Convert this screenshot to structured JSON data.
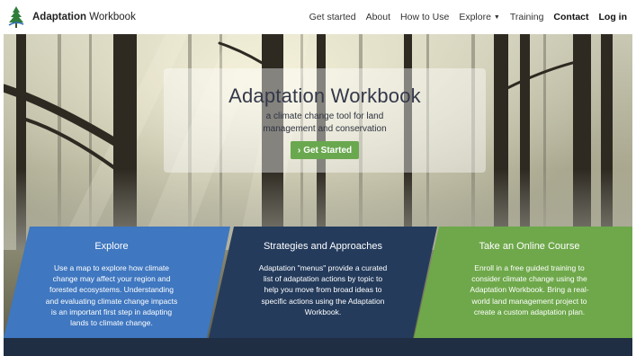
{
  "brand": {
    "name_bold": "Adaptation",
    "name_rest": " Workbook",
    "icon": "tree-logo-icon"
  },
  "nav": {
    "items": [
      {
        "label": "Get started"
      },
      {
        "label": "About"
      },
      {
        "label": "How to Use"
      },
      {
        "label": "Explore"
      },
      {
        "label": "Training"
      },
      {
        "label": "Contact"
      },
      {
        "label": "Log in"
      }
    ],
    "dropdown_icon": "caret-down-icon"
  },
  "hero": {
    "title": "Adaptation Workbook",
    "subtitle_line1": "a climate change tool for land",
    "subtitle_line2": "management and conservation",
    "button_label": "Get Started",
    "button_icon": "chevron-right-icon",
    "button_color": "#6aa84f"
  },
  "panels": [
    {
      "title": "Explore",
      "color": "#3f77c0",
      "lines": [
        "Use a map to explore how climate",
        "change may affect your region and",
        "forested ecosystems. Understanding",
        "and evaluating climate change impacts",
        "is an important first step in adapting",
        "lands to climate change."
      ]
    },
    {
      "title": "Strategies and Approaches",
      "color": "#243b5c",
      "lines": [
        "Adaptation \"menus\" provide a curated",
        "list of adaptation actions by topic to",
        "help you move from broad ideas to",
        "specific actions using the Adaptation",
        "Workbook."
      ]
    },
    {
      "title": "Take an Online Course",
      "color": "#6ea84a",
      "lines": [
        "Enroll in a free guided training to",
        "consider climate change using the",
        "Adaptation Workbook. Bring a real-",
        "world land management project to",
        "create a custom adaptation plan."
      ]
    }
  ]
}
